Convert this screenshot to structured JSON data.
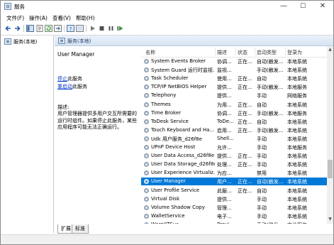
{
  "window": {
    "title": "服务",
    "controls": {
      "minimize": "—",
      "maximize": "☐",
      "close": "✕"
    }
  },
  "menu": [
    "文件(F)",
    "操作(A)",
    "查看(V)",
    "帮助(H)"
  ],
  "toolbar_icons": [
    "back-arrow-icon",
    "forward-arrow-icon",
    "console-tree-icon",
    "properties-icon",
    "refresh-icon",
    "export-icon",
    "help-icon",
    "help-book-icon",
    "play-icon",
    "stop-icon",
    "pause-icon",
    "restart-icon"
  ],
  "tree": {
    "root_label": "服务(本地)"
  },
  "pane": {
    "header_label": "服务(本地)"
  },
  "description": {
    "service_title": "User Manager",
    "action_stop": "停止",
    "action_stop_suffix": "此服务",
    "action_restart": "重启动",
    "action_restart_suffix": "此服务",
    "label": "描述:",
    "text": "用户管理器提供多用户交互所需要的运行时组件。如果停止此服务，某些应用程序可能无法正确运行。"
  },
  "columns": {
    "name": "名称",
    "description": "描述",
    "status": "状态",
    "startup": "启动类型",
    "logon": "登录为"
  },
  "services": [
    {
      "name": "System Events Broker",
      "description": "协调...",
      "status": "正在...",
      "startup": "自动(触发...",
      "logon": "本地系统"
    },
    {
      "name": "System Guard 运行时监视...",
      "description": "监视...",
      "status": "",
      "startup": "手动(触发...",
      "logon": "本地系统"
    },
    {
      "name": "Task Scheduler",
      "description": "使用...",
      "status": "正在...",
      "startup": "自动",
      "logon": "本地系统"
    },
    {
      "name": "TCP/IP NetBIOS Helper",
      "description": "提供...",
      "status": "正在...",
      "startup": "手动(触发...",
      "logon": "本地服务"
    },
    {
      "name": "Telephony",
      "description": "提供...",
      "status": "",
      "startup": "手动",
      "logon": "网络服务"
    },
    {
      "name": "Themes",
      "description": "为用...",
      "status": "正在...",
      "startup": "自动",
      "logon": "本地系统"
    },
    {
      "name": "Time Broker",
      "description": "协调...",
      "status": "正在...",
      "startup": "手动(触发...",
      "logon": "本地服务"
    },
    {
      "name": "ToDesk Service",
      "description": "ToDe...",
      "status": "正在...",
      "startup": "自动",
      "logon": "本地系统"
    },
    {
      "name": "Touch Keyboard and Ha...",
      "description": "启用...",
      "status": "正在...",
      "startup": "手动(触发...",
      "logon": "本地系统"
    },
    {
      "name": "Udk 用户服务_d26f8e",
      "description": "Shell...",
      "status": "",
      "startup": "手动",
      "logon": "本地系统"
    },
    {
      "name": "UPnP Device Host",
      "description": "允许...",
      "status": "",
      "startup": "手动",
      "logon": "本地服务"
    },
    {
      "name": "User Data Access_d26f8e",
      "description": "提供...",
      "status": "正在...",
      "startup": "手动",
      "logon": "本地系统"
    },
    {
      "name": "User Data Storage_d26f8e",
      "description": "处理...",
      "status": "正在...",
      "startup": "手动",
      "logon": "本地系统"
    },
    {
      "name": "User Experience Virtualiz...",
      "description": "为应...",
      "status": "",
      "startup": "禁用",
      "logon": "本地系统"
    },
    {
      "name": "User Manager",
      "description": "用户...",
      "status": "正在...",
      "startup": "自动(触发...",
      "logon": "本地系统",
      "selected": true
    },
    {
      "name": "User Profile Service",
      "description": "此服...",
      "status": "正在...",
      "startup": "自动",
      "logon": "本地系统"
    },
    {
      "name": "Virtual Disk",
      "description": "提供...",
      "status": "",
      "startup": "手动",
      "logon": "本地系统"
    },
    {
      "name": "Volume Shadow Copy",
      "description": "管理...",
      "status": "",
      "startup": "手动",
      "logon": "本地系统"
    },
    {
      "name": "WalletService",
      "description": "电子...",
      "status": "",
      "startup": "手动",
      "logon": "本地系统"
    },
    {
      "name": "WarpJITSvc",
      "description": "Provi...",
      "status": "",
      "startup": "手动(触发...",
      "logon": "本地服务"
    }
  ],
  "tabs": [
    {
      "label": "扩展",
      "active": true
    },
    {
      "label": "标准",
      "active": false
    }
  ],
  "colors": {
    "selection": "#0078d7",
    "link": "#0033cc",
    "header_text": "#1e3a5f"
  }
}
